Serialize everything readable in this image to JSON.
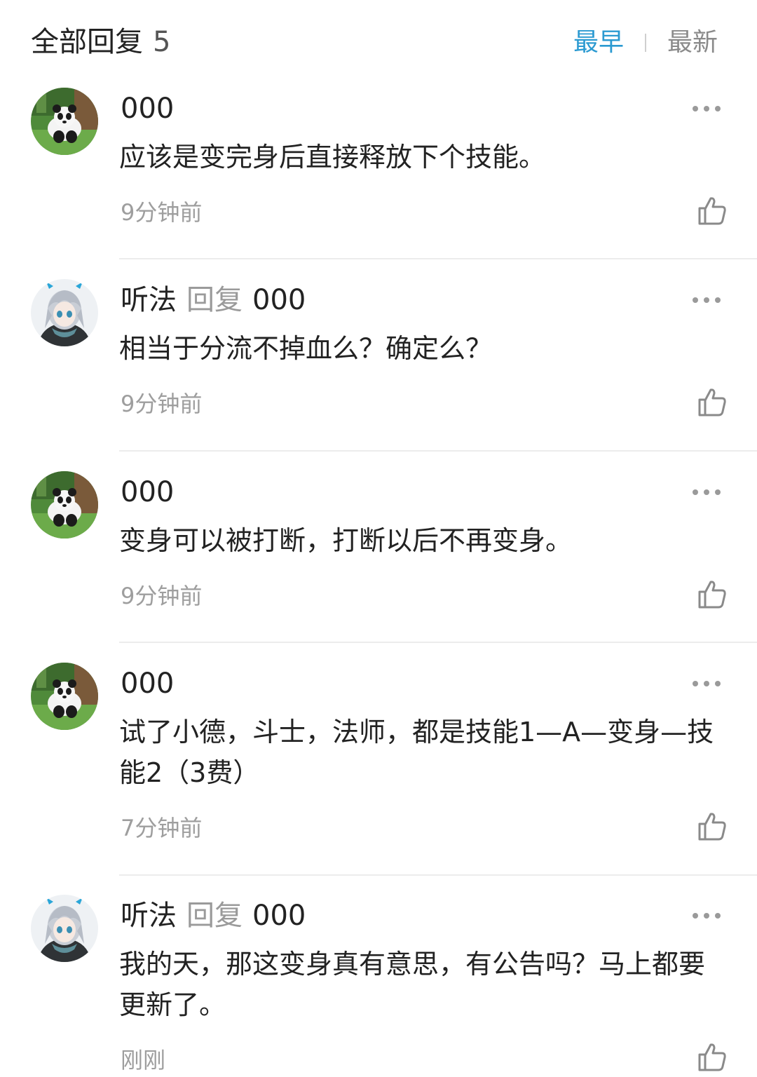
{
  "header": {
    "title": "全部回复",
    "count": "5",
    "sort_options": [
      "最早",
      "最新"
    ],
    "active_sort": "最早",
    "accent_color": "#2b9ad1"
  },
  "reply_word": "回复",
  "replies": [
    {
      "author": "000",
      "reply_to": "",
      "avatar": "panda-avatar",
      "content": "应该是变完身后直接释放下个技能。",
      "time": "9分钟前"
    },
    {
      "author": "听法",
      "reply_to": "000",
      "avatar": "anime-girl-avatar",
      "content": "相当于分流不掉血么？确定么？",
      "time": "9分钟前"
    },
    {
      "author": "000",
      "reply_to": "",
      "avatar": "panda-avatar",
      "content": "变身可以被打断，打断以后不再变身。",
      "time": "9分钟前"
    },
    {
      "author": "000",
      "reply_to": "",
      "avatar": "panda-avatar",
      "content": "试了小德，斗士，法师，都是技能1—A—变身—技能2（3费）",
      "time": "7分钟前"
    },
    {
      "author": "听法",
      "reply_to": "000",
      "avatar": "anime-girl-avatar",
      "content": "我的天，那这变身真有意思，有公告吗？马上都要更新了。",
      "time": "刚刚"
    }
  ]
}
